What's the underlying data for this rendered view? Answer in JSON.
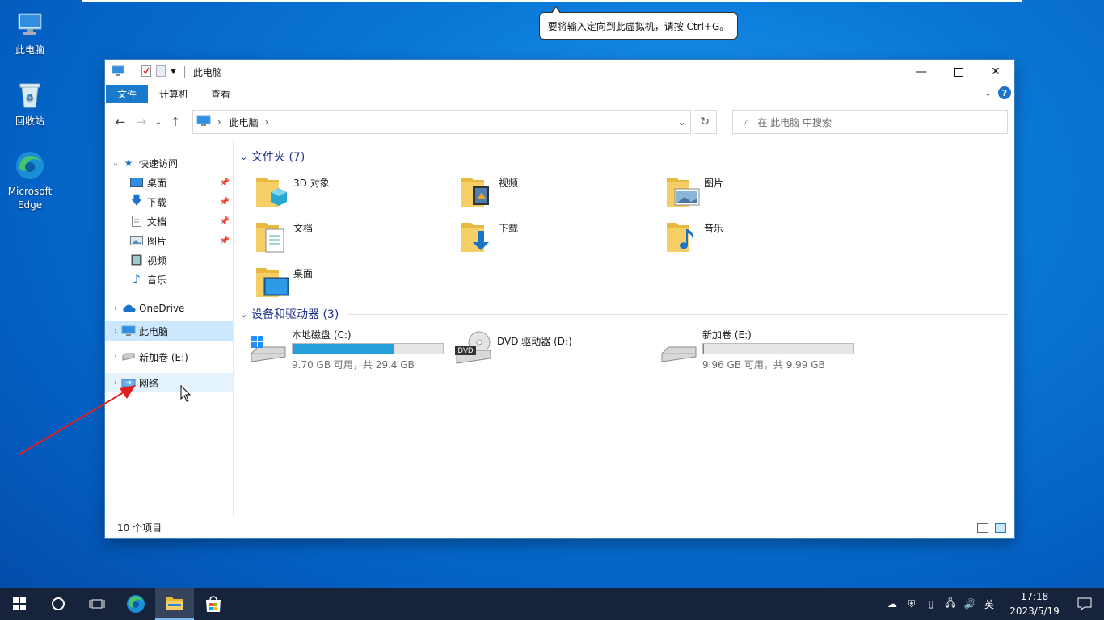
{
  "tooltip": "要将输入定向到此虚拟机，请按 Ctrl+G。",
  "desktop": {
    "icons": [
      "此电脑",
      "回收站",
      "Microsoft Edge"
    ]
  },
  "window": {
    "title": "此电脑",
    "ribbon_tabs": [
      "文件",
      "计算机",
      "查看"
    ],
    "address_crumb": "此电脑",
    "search_placeholder": "在 此电脑 中搜索",
    "nav": {
      "quick_access": "快速访问",
      "quick_items": [
        "桌面",
        "下载",
        "文档",
        "图片",
        "视频",
        "音乐"
      ],
      "onedrive": "OneDrive",
      "this_pc": "此电脑",
      "new_volume": "新加卷 (E:)",
      "network": "网络"
    },
    "folders_header": "文件夹 (7)",
    "folders": [
      "3D 对象",
      "视频",
      "图片",
      "文档",
      "下载",
      "音乐",
      "桌面"
    ],
    "drives_header": "设备和驱动器 (3)",
    "drives": [
      {
        "name": "本地磁盘 (C:)",
        "free": "9.70 GB 可用，共 29.4 GB",
        "used_fraction": 0.67
      },
      {
        "name": "DVD 驱动器 (D:)",
        "free": "",
        "used_fraction": null
      },
      {
        "name": "新加卷 (E:)",
        "free": "9.96 GB 可用，共 9.99 GB",
        "used_fraction": 0.003
      }
    ],
    "status": "10 个项目"
  },
  "taskbar": {
    "ime": "英",
    "time": "17:18",
    "date": "2023/5/19"
  },
  "colors": {
    "accent": "#1979ca",
    "bar_fill": "#26a0da",
    "group_header": "#1e3287",
    "taskbar": "#16233a",
    "annotation_arrow": "#e02020"
  }
}
